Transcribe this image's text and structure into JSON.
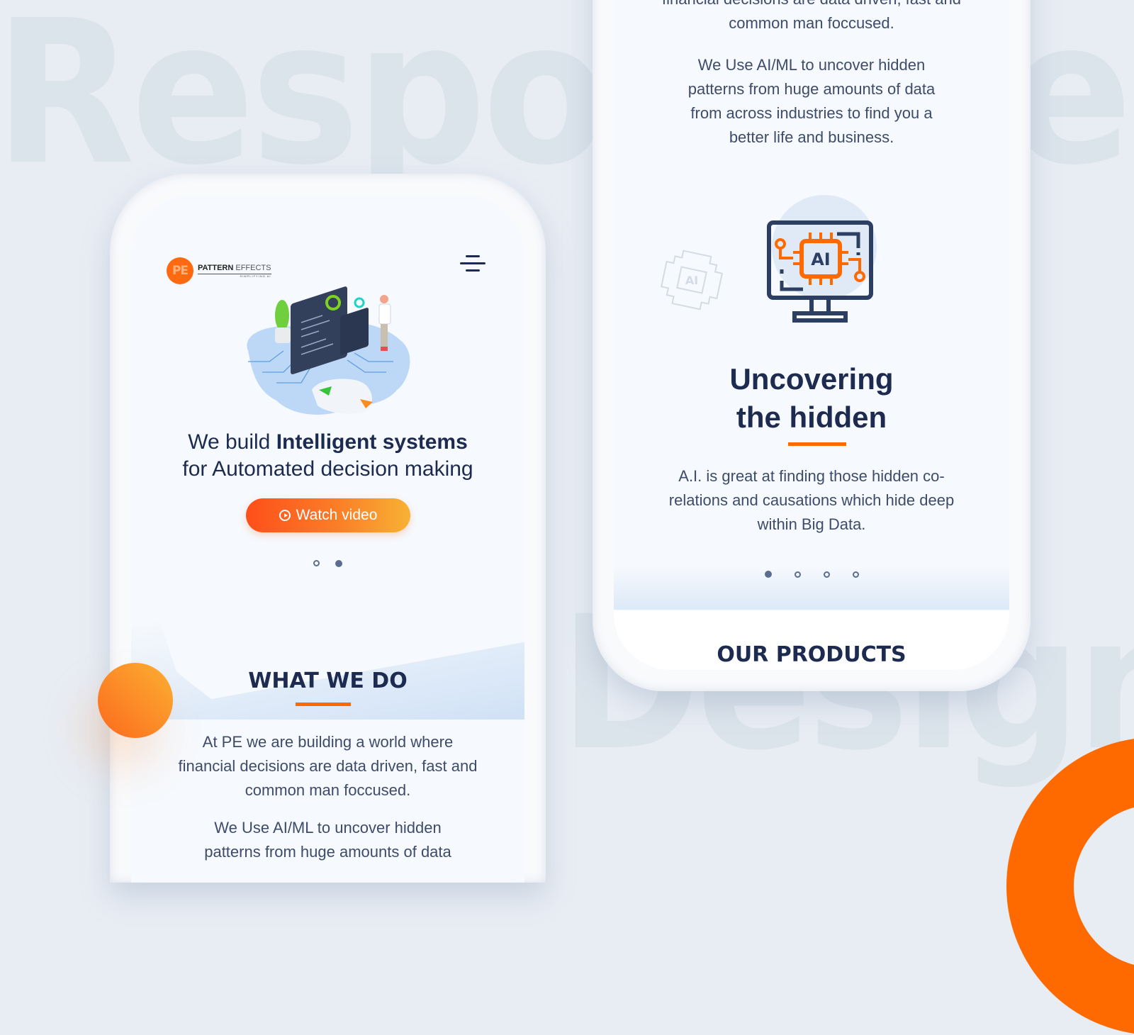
{
  "background": {
    "word_top": "Responsive",
    "word_bottom": "Design",
    "accent_color": "#ff6a00"
  },
  "left_phone": {
    "brand": {
      "mark": "PE",
      "name_bold": "PATTERN",
      "name_light": "EFFECTS",
      "tagline": "SIMPLIFYING AI"
    },
    "menu_icon": "hamburger-menu-icon",
    "hero": {
      "title_prefix": "We build ",
      "title_bold": "Intelligent systems",
      "title_line2": "for Automated decision making",
      "cta_label": "Watch video",
      "cta_icon": "play-circle-icon",
      "slides": 2,
      "active_slide": 2
    },
    "what_we_do": {
      "title": "WHAT WE DO",
      "para1_l1": "At PE we are building a world where",
      "para1_l2": "financial decisions are data driven, fast and",
      "para1_l3": "common man foccused.",
      "para2_l1": "We Use AI/ML to uncover hidden",
      "para2_l2": "patterns from huge amounts of data"
    }
  },
  "right_phone": {
    "top_text": {
      "l1": "financial decisions are data driven, fast and",
      "l2": "common man foccused.",
      "p2_l1": "We Use AI/ML to uncover hidden",
      "p2_l2": "patterns from huge amounts of data",
      "p2_l3": "from across industries to find you a",
      "p2_l4": "better life and business."
    },
    "feature": {
      "icon": "ai-monitor-icon",
      "icon_label": "AI",
      "title_l1": "Uncovering",
      "title_l2": "the hidden",
      "desc_l1": "A.I. is great at finding those hidden co-",
      "desc_l2": "relations and causations which hide deep",
      "desc_l3": "within Big Data.",
      "slides": 4,
      "active_slide": 1
    },
    "products_title": "OUR PRODUCTS"
  }
}
